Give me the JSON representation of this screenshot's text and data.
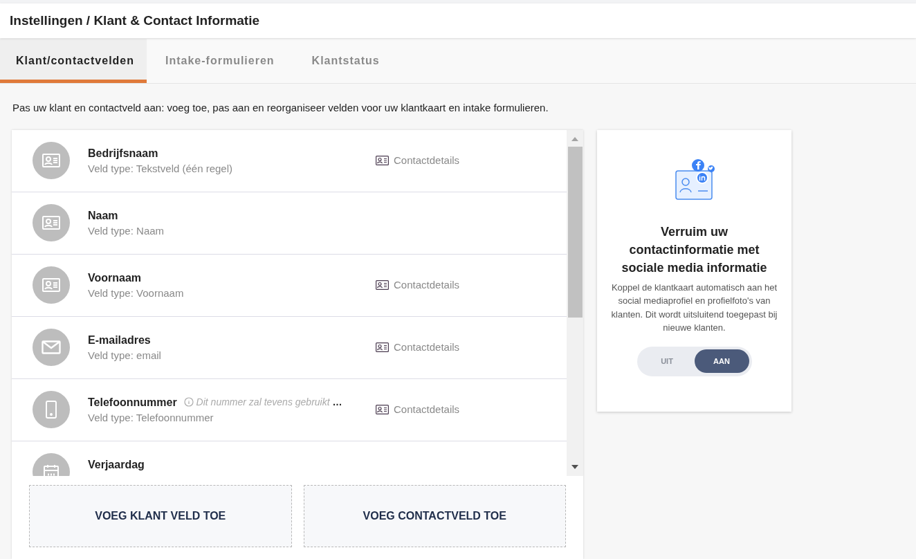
{
  "title": "Instellingen / Klant & Contact Informatie",
  "tabs": [
    {
      "label": "Klant/contactvelden",
      "selected": true
    },
    {
      "label": "Intake-formulieren",
      "selected": false
    },
    {
      "label": "Klantstatus",
      "selected": false
    }
  ],
  "description": "Pas uw klant en contactveld aan: voeg toe, pas aan en reorganiseer velden voor uw klantkaart en intake formulieren.",
  "fields": [
    {
      "kind": "card",
      "name": "Bedrijfsnaam",
      "type": "Veld type: Tekstveld (één regel)",
      "category": "Contactdetails"
    },
    {
      "kind": "card",
      "name": "Naam",
      "type": "Veld type: Naam"
    },
    {
      "kind": "card",
      "name": "Voornaam",
      "type": "Veld type: Voornaam",
      "category": "Contactdetails"
    },
    {
      "kind": "mail",
      "name": "E-mailadres",
      "type": "Veld type: email",
      "category": "Contactdetails"
    },
    {
      "kind": "phone",
      "name": "Telefoonnummer",
      "hint": "Dit nummer zal tevens gebruikt",
      "more": "…",
      "type": "Veld type: Telefoonnummer",
      "category": "Contactdetails"
    },
    {
      "kind": "calendar",
      "name": "Verjaardag"
    }
  ],
  "buttons": [
    "VOEG KLANT VELD TOE",
    "VOEG CONTACTVELD TOE"
  ],
  "promo": {
    "title": "Verruim uw contactinformatie met sociale media informatie",
    "text": "Koppel de klantkaart automatisch aan het social mediaprofiel en profielfoto's van klanten. Dit wordt uitsluitend toegepast bij nieuwe klanten.",
    "toggle": [
      {
        "label": "UIT",
        "selected": false
      },
      {
        "label": "AAN",
        "selected": true
      }
    ]
  }
}
